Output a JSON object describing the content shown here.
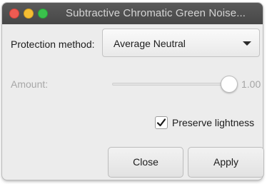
{
  "window": {
    "title": "Subtractive Chromatic Green Noise..."
  },
  "protection": {
    "label": "Protection method:",
    "selected": "Average Neutral"
  },
  "amount": {
    "label": "Amount:",
    "value": "1.00",
    "enabled": false
  },
  "preserve_lightness": {
    "label": "Preserve lightness",
    "checked": true
  },
  "buttons": {
    "close_label": "Close",
    "apply_label": "Apply"
  },
  "icons": {
    "traffic_close": "close-window-icon",
    "traffic_minimize": "minimize-window-icon",
    "traffic_maximize": "maximize-window-icon",
    "dropdown": "chevron-down-icon",
    "check": "checkmark-icon"
  },
  "colors": {
    "titlebar": "#4f4f4f",
    "window_bg": "#ececec",
    "traffic_close": "#ef5b52",
    "traffic_minimize": "#f5be33",
    "traffic_maximize": "#3ac14c"
  }
}
